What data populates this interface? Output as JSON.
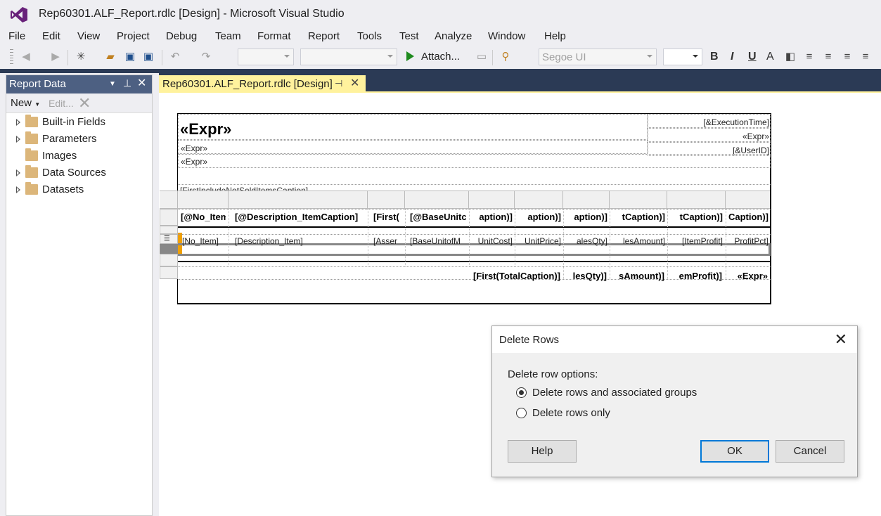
{
  "window": {
    "title": "Rep60301.ALF_Report.rdlc [Design] - Microsoft Visual Studio"
  },
  "menu": [
    "File",
    "Edit",
    "View",
    "Project",
    "Debug",
    "Team",
    "Format",
    "Report",
    "Tools",
    "Test",
    "Analyze",
    "Window",
    "Help"
  ],
  "toolbar": {
    "attach_label": "Attach...",
    "font_name": "Segoe UI",
    "format_buttons": [
      "B",
      "I",
      "U",
      "A"
    ]
  },
  "report_data_panel": {
    "title": "Report Data",
    "new_label": "New",
    "edit_label": "Edit...",
    "items": [
      {
        "label": "Built-in Fields",
        "expandable": true
      },
      {
        "label": "Parameters",
        "expandable": true
      },
      {
        "label": "Images",
        "expandable": false
      },
      {
        "label": "Data Sources",
        "expandable": true
      },
      {
        "label": "Datasets",
        "expandable": true
      }
    ]
  },
  "document_tab": {
    "label": "Rep60301.ALF_Report.rdlc [Design]"
  },
  "report": {
    "title_expr": "«Expr»",
    "sub_expr_1": "«Expr»",
    "sub_expr_2": "«Expr»",
    "execution_time": "[&ExecutionTime]",
    "right_expr": "«Expr»",
    "user_id": "[&UserID]",
    "partial_row": "[FirstIncludeNotSoldItemsCaption]",
    "header_cells": [
      "[@No_Item",
      "[@Description_ItemCaption]",
      "[First(",
      "[@BaseUnitc",
      "aption)]",
      "aption)]",
      "aption)]",
      "tCaption)]",
      "tCaption)]",
      "Caption)]"
    ],
    "detail_cells": [
      "[No_Item]",
      "[Description_Item]",
      "[Asser",
      "[BaseUnitofM",
      "UnitCost]",
      "UnitPrice]",
      "alesQty]",
      "lesAmount]",
      "[ItemProfit]",
      "ProfitPct]"
    ],
    "total_cells": [
      "[First(TotalCaption)]",
      "lesQty)]",
      "sAmount)]",
      "emProfit)]",
      "«Expr»"
    ]
  },
  "dialog": {
    "title": "Delete Rows",
    "options_label": "Delete row options:",
    "options": [
      {
        "label": "Delete rows and associated groups",
        "selected": true
      },
      {
        "label": "Delete rows only",
        "selected": false
      }
    ],
    "help_label": "Help",
    "ok_label": "OK",
    "cancel_label": "Cancel"
  }
}
